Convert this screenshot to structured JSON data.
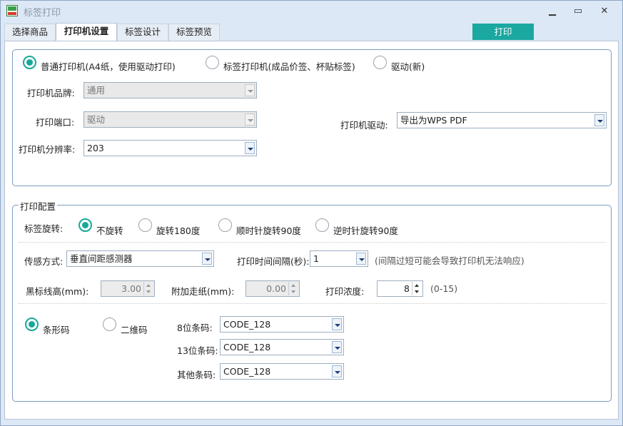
{
  "window": {
    "title": "标签打印",
    "minimize": "▁",
    "maximize": "▭",
    "close": "✕"
  },
  "tabs": [
    {
      "label": "选择商品"
    },
    {
      "label": "打印机设置"
    },
    {
      "label": "标签设计"
    },
    {
      "label": "标签预览"
    }
  ],
  "print_button": "打印",
  "printer": {
    "options": [
      "普通打印机(A4纸，使用驱动打印)",
      "标签打印机(成品价签、杯贴标签)",
      "驱动(新)"
    ],
    "brand_label": "打印机品牌:",
    "brand_value": "通用",
    "port_label": "打印端口:",
    "port_value": "驱动",
    "resolution_label": "打印机分辨率:",
    "resolution_value": "203",
    "driver_label": "打印机驱动:",
    "driver_value": "导出为WPS PDF"
  },
  "config": {
    "title": "打印配置",
    "rotation_label": "标签旋转:",
    "rotation_options": [
      "不旋转",
      "旋转180度",
      "顺时针旋转90度",
      "逆时针旋转90度"
    ],
    "sensor_label": "传感方式:",
    "sensor_value": "垂直间距感测器",
    "interval_label": "打印时间间隔(秒):",
    "interval_value": "1",
    "interval_hint": "(间隔过短可能会导致打印机无法响应)",
    "blackline_label": "黑标线高(mm):",
    "blackline_value": "3.00",
    "feed_label": "附加走纸(mm):",
    "feed_value": "0.00",
    "density_label": "打印浓度:",
    "density_value": "8",
    "density_hint": "(0-15)",
    "code_options": [
      "条形码",
      "二维码"
    ],
    "code8_label": "8位条码:",
    "code8_value": "CODE_128",
    "code13_label": "13位条码:",
    "code13_value": "CODE_128",
    "code_other_label": "其他条码:",
    "code_other_value": "CODE_128"
  }
}
